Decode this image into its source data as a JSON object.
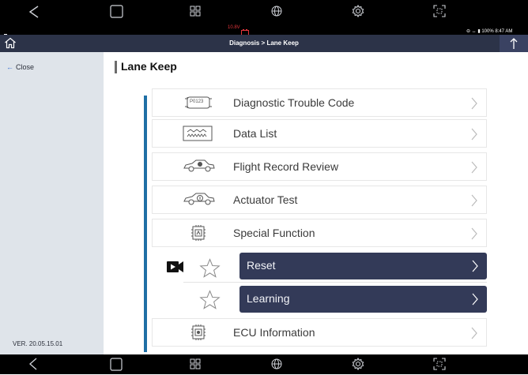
{
  "system": {
    "battery_voltage": "10.8V",
    "status_right": "⊖ ↔ ▮ 100% 8:47 AM"
  },
  "header": {
    "breadcrumb": "Diagnosis > Lane Keep"
  },
  "sidebar": {
    "close_label": "Close",
    "close_arrow": "←",
    "version": "VER. 20.05.15.01"
  },
  "page": {
    "title": "Lane Keep"
  },
  "menu": {
    "items": [
      {
        "label": "Diagnostic Trouble Code",
        "icon": "dtc-icon",
        "chip": "P0123"
      },
      {
        "label": "Data List",
        "icon": "data-list-icon"
      },
      {
        "label": "Flight Record Review",
        "icon": "car-icon"
      },
      {
        "label": "Actuator Test",
        "icon": "car-actuator-icon"
      },
      {
        "label": "Special Function",
        "icon": "chip-icon"
      },
      {
        "label": "Reset",
        "icon": "star-icon",
        "style": "dark"
      },
      {
        "label": "Learning",
        "icon": "star-icon",
        "style": "dark"
      },
      {
        "label": "ECU Information",
        "icon": "ecu-chip-icon"
      }
    ]
  },
  "colors": {
    "nav_bar": "#2c3348",
    "sidebar": "#dfe4ea",
    "accent": "#1f6fa5",
    "dark_row": "#333a58",
    "battery_warning": "#e2353b"
  }
}
